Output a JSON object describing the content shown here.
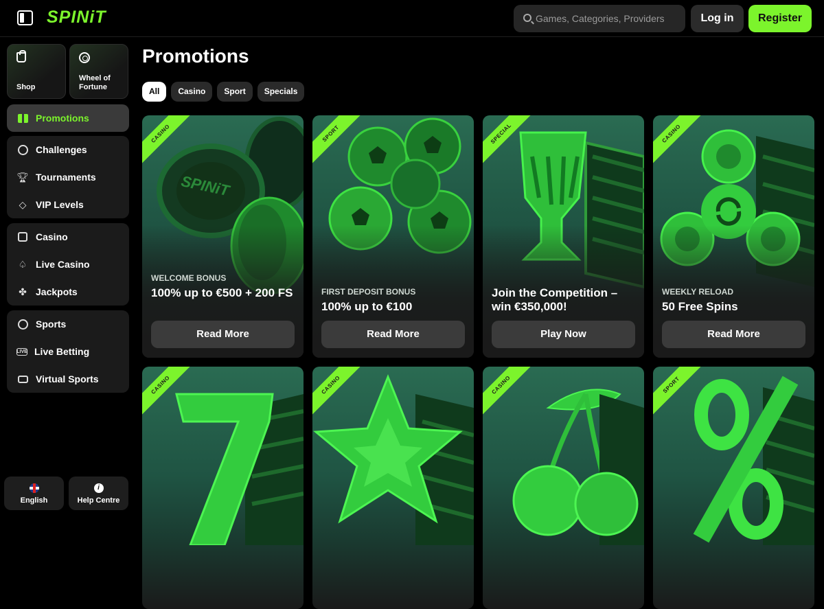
{
  "header": {
    "logo": "SPINiT",
    "search_placeholder": "Games, Categories, Providers",
    "login_label": "Log in",
    "register_label": "Register"
  },
  "sidebar": {
    "tiles": [
      {
        "label": "Shop",
        "icon": "shopping-bag-icon"
      },
      {
        "label": "Wheel of Fortune",
        "icon": "wheel-icon"
      }
    ],
    "active_item": {
      "label": "Promotions",
      "icon": "gift-icon"
    },
    "groups": [
      {
        "items": [
          {
            "label": "Challenges",
            "icon": "target-icon"
          },
          {
            "label": "Tournaments",
            "icon": "trophy-icon"
          },
          {
            "label": "VIP Levels",
            "icon": "diamond-icon"
          }
        ]
      },
      {
        "items": [
          {
            "label": "Casino",
            "icon": "slot-machine-icon"
          },
          {
            "label": "Live Casino",
            "icon": "cards-icon"
          },
          {
            "label": "Jackpots",
            "icon": "clover-icon"
          }
        ]
      },
      {
        "items": [
          {
            "label": "Sports",
            "icon": "soccer-ball-icon"
          },
          {
            "label": "Live Betting",
            "icon": "live-icon"
          },
          {
            "label": "Virtual Sports",
            "icon": "monitor-icon"
          }
        ]
      }
    ],
    "footer": [
      {
        "label": "English",
        "icon": "uk-flag-icon"
      },
      {
        "label": "Help Centre",
        "icon": "info-icon"
      }
    ]
  },
  "main": {
    "title": "Promotions",
    "filters": [
      {
        "label": "All",
        "active": true
      },
      {
        "label": "Casino",
        "active": false
      },
      {
        "label": "Sport",
        "active": false
      },
      {
        "label": "Specials",
        "active": false
      }
    ],
    "cards": [
      {
        "tag": "CASINO",
        "subtitle": "WELCOME BONUS",
        "title": "100% up to €500 + 200 FS",
        "cta": "Read More",
        "art": "casino-chips"
      },
      {
        "tag": "SPORT",
        "subtitle": "FIRST DEPOSIT BONUS",
        "title": "100% up to €100",
        "cta": "Read More",
        "art": "soccer-balls"
      },
      {
        "tag": "SPECIAL",
        "subtitle": "",
        "title": "Join the Competition – win €350,000!",
        "cta": "Play Now",
        "art": "trophy"
      },
      {
        "tag": "CASINO",
        "subtitle": "WEEKLY RELOAD",
        "title": "50 Free Spins",
        "cta": "Read More",
        "art": "fidget-spinner"
      },
      {
        "tag": "CASINO",
        "subtitle": "",
        "title": "",
        "cta": "",
        "art": "lucky-seven"
      },
      {
        "tag": "CASINO",
        "subtitle": "",
        "title": "",
        "cta": "",
        "art": "star"
      },
      {
        "tag": "CASINO",
        "subtitle": "",
        "title": "",
        "cta": "",
        "art": "cherries"
      },
      {
        "tag": "SPORT",
        "subtitle": "",
        "title": "",
        "cta": "",
        "art": "percent"
      }
    ]
  },
  "colors": {
    "accent": "#7cf42c",
    "background": "#000000",
    "panel": "#1b1b1b",
    "card_top": "#2a6b52"
  }
}
